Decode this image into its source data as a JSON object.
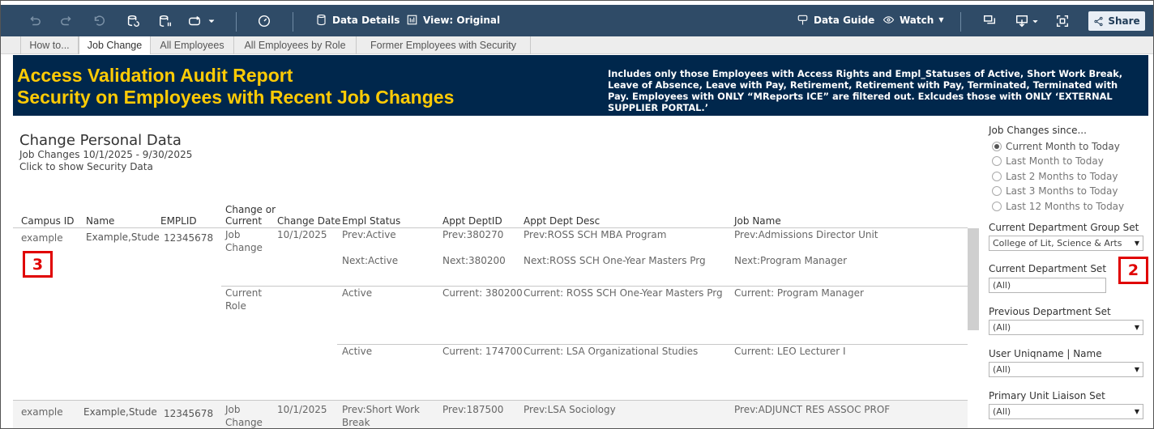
{
  "toolbar": {
    "data_details": "Data Details",
    "view_original": "View: Original",
    "data_guide": "Data Guide",
    "watch": "Watch",
    "share": "Share"
  },
  "tabs": [
    {
      "label": "How to..."
    },
    {
      "label": "Job Change"
    },
    {
      "label": "All Employees"
    },
    {
      "label": "All Employees by Role"
    },
    {
      "label": "Former Employees with Security"
    }
  ],
  "banner": {
    "title_line1": "Access Validation Audit Report",
    "title_line2": "Security on Employees with Recent Job Changes",
    "note": "Includes only those Employees with Access Rights and Empl_Statuses of Active, Short Work Break, Leave of Absence, Leave with Pay, Retirement, Retirement with Pay, Terminated, Terminated with Pay. Employees with ONLY “MReports ICE” are filtered out.   Exlcudes those with ONLY ‘EXTERNAL SUPPLIER PORTAL.’"
  },
  "report": {
    "title": "Change Personal Data",
    "subtitle1": "Job Changes  10/1/2025 - 9/30/2025",
    "subtitle2": "Click to show Security Data",
    "columns": {
      "campus_id": "Campus ID",
      "name": "Name",
      "emplid": "EMPLID",
      "change_or_current_1": "Change or",
      "change_or_current_2": "Current",
      "change_date": "Change Date",
      "empl_status": "Empl  Status",
      "appt_deptid": "Appt DeptID",
      "appt_dept_desc": "Appt Dept Desc",
      "job_name": "Job Name"
    },
    "rows": [
      {
        "campus_id": "example",
        "name": "Example,Stude",
        "emplid": "12345678",
        "change1": "Job",
        "change2": "Change",
        "change_date": "10/1/2025",
        "prev_status": "Prev:Active",
        "prev_dept": "Prev:380270",
        "prev_desc": "Prev:ROSS SCH MBA Program",
        "prev_job": "Prev:Admissions Director Unit",
        "next_status": "Next:Active",
        "next_dept": "Next:380200",
        "next_desc": "Next:ROSS SCH One-Year Masters Prg",
        "next_job": "Next:Program Manager",
        "current1": "Current",
        "current2": "Role",
        "cur_status": "Active",
        "cur_dept": "Current: 380200",
        "cur_desc": "Current: ROSS SCH One-Year Masters Prg",
        "cur_job": "Current: Program Manager",
        "cur2_status": "Active",
        "cur2_dept": "Current: 174700",
        "cur2_desc": "Current: LSA Organizational Studies",
        "cur2_job": "Current: LEO Lecturer I"
      },
      {
        "campus_id": "example",
        "name": "Example,Stude",
        "emplid": "12345678",
        "change1": "Job",
        "change2": "Change",
        "change_date": "10/1/2025",
        "prev_status1": "Prev:Short Work",
        "prev_status2": "Break",
        "prev_dept": "Prev:187500",
        "prev_desc": "Prev:LSA Sociology",
        "prev_job": "Prev:ADJUNCT RES ASSOC PROF"
      }
    ]
  },
  "filters": {
    "job_changes_label": "Job Changes since...",
    "radio_options": [
      {
        "label": "Current Month to Today",
        "selected": true
      },
      {
        "label": "Last Month to Today",
        "selected": false
      },
      {
        "label": "Last 2 Months to Today",
        "selected": false
      },
      {
        "label": "Last 3 Months to Today",
        "selected": false
      },
      {
        "label": "Last 12 Months to Today",
        "selected": false
      }
    ],
    "current_dept_group_label": "Current Department Group Set",
    "current_dept_group_value": "College of Lit, Science & Arts",
    "current_dept_set_label": "Current Department Set",
    "current_dept_set_value": "(All)",
    "previous_dept_set_label": "Previous Department Set",
    "previous_dept_set_value": "(All)",
    "user_uniqname_label": "User Uniqname | Name",
    "user_uniqname_value": "(All)",
    "primary_liaison_label": "Primary Unit Liaison Set",
    "primary_liaison_value": "(All)"
  },
  "callouts": {
    "left": "3",
    "right": "2"
  },
  "colors": {
    "toolbar_bg": "#2f4b67",
    "banner_bg": "#00274c",
    "banner_title": "#ffcb05",
    "callout": "#e00000"
  }
}
